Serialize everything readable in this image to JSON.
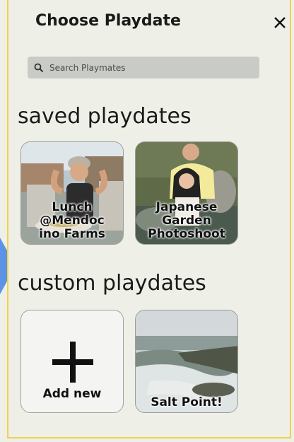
{
  "header": {
    "title": "Choose Playdate"
  },
  "search": {
    "placeholder": "Search Playmates"
  },
  "saved": {
    "heading": "saved playdates",
    "cards": [
      {
        "label": "Lunch\n@Mendoc\nino Farms"
      },
      {
        "label": "Japanese\nGarden\nPhotoshoot"
      }
    ]
  },
  "custom": {
    "heading": "custom playdates",
    "add_label": "Add new",
    "cards": [
      {
        "label": "Salt Point!"
      }
    ]
  },
  "colors": {
    "accent_arrow": "#5b93e6",
    "panel_border": "#f2d14a",
    "background": "#eef0e7"
  },
  "icons": {
    "close": "close-icon",
    "search": "search-icon",
    "add": "plus-icon"
  }
}
